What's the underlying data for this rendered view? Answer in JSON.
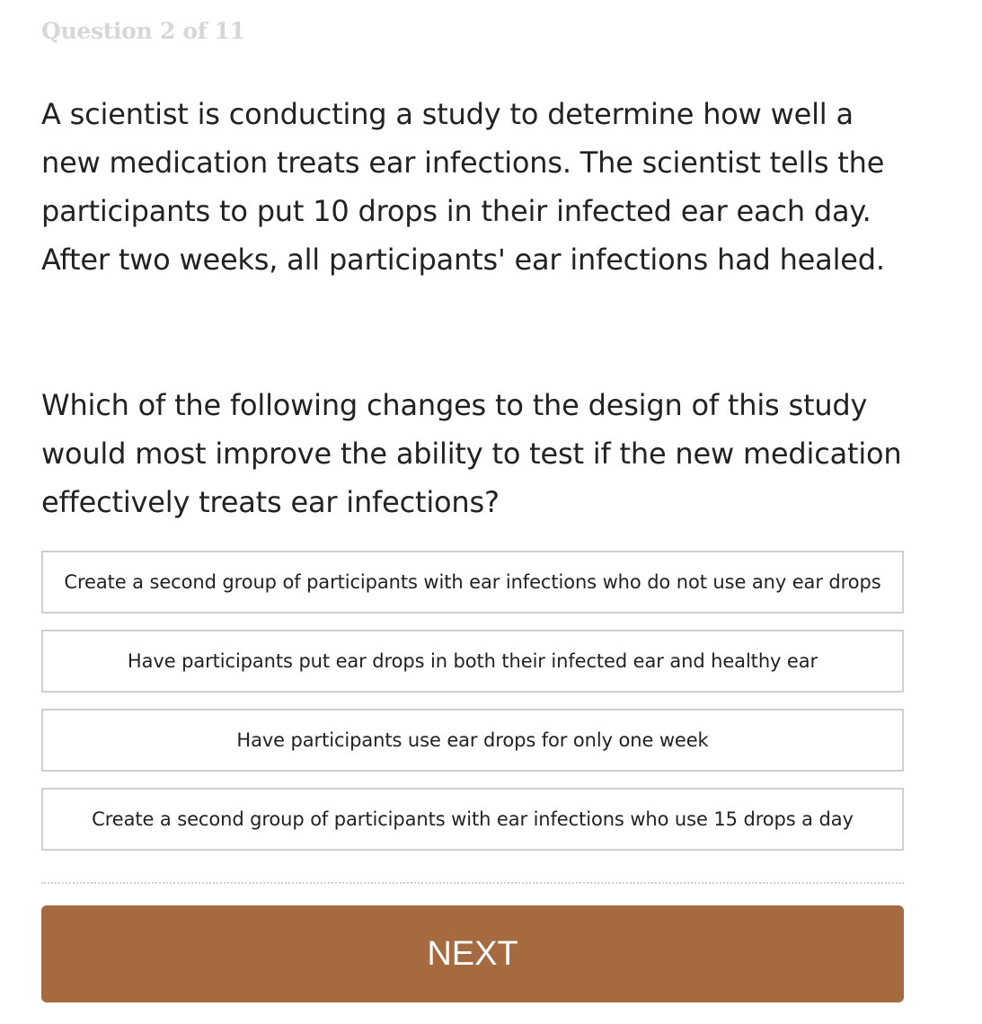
{
  "progress": {
    "text": "Question 2 of 11"
  },
  "scenario": "A scientist is conducting a study to determine how well a new medication treats ear infections. The scientist tells the participants to put 10 drops in their infected ear each day. After two weeks, all participants' ear infections had healed.",
  "question": "Which of the following changes to the design of this study would most improve the ability to test if the new medication effectively treats ear infections?",
  "options": [
    {
      "label": "Create a second group of participants with ear infections who do not use any ear drops"
    },
    {
      "label": "Have participants put ear drops in both their infected ear and healthy ear"
    },
    {
      "label": "Have participants use ear drops for only one week"
    },
    {
      "label": "Create a second group of participants with ear infections who use 15 drops a day"
    }
  ],
  "next_button": {
    "label": "NEXT"
  },
  "colors": {
    "accent": "#a66a41",
    "progress_text": "#d7d7d7",
    "option_border": "#cfcfcf"
  }
}
